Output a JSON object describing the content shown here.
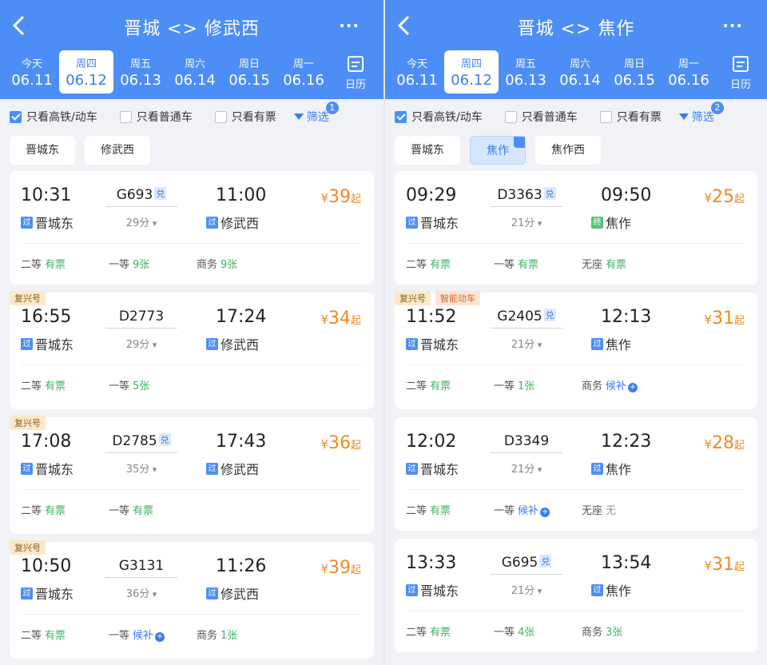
{
  "left": {
    "title": "晋城 <> 修武西",
    "more": "···",
    "dates": [
      {
        "wk": "今天",
        "dt": "06.11"
      },
      {
        "wk": "周四",
        "dt": "06.12",
        "sel": true
      },
      {
        "wk": "周五",
        "dt": "06.13"
      },
      {
        "wk": "周六",
        "dt": "06.14"
      },
      {
        "wk": "周日",
        "dt": "06.15"
      },
      {
        "wk": "周一",
        "dt": "06.16"
      }
    ],
    "calendar": "日历",
    "filters": {
      "hsr": "只看高铁/动车",
      "normal": "只看普通车",
      "avail": "只看有票",
      "screen": "筛选",
      "badge": "1"
    },
    "stations": [
      "晋城东",
      "修武西"
    ],
    "trains": [
      {
        "dep": "10:31",
        "arr": "11:00",
        "no": "G693",
        "dui": "兑",
        "dur": "29分",
        "ds": "晋城东",
        "as": "修武西",
        "asb": "过",
        "price": "39",
        "seats": [
          [
            "二等",
            "有票",
            "g"
          ],
          [
            "一等",
            "9张",
            "g"
          ],
          [
            "商务",
            "9张",
            "g"
          ]
        ]
      },
      {
        "tag": "复兴号",
        "dep": "16:55",
        "arr": "17:24",
        "no": "D2773",
        "dur": "29分",
        "ds": "晋城东",
        "as": "修武西",
        "asb": "过",
        "price": "34",
        "seats": [
          [
            "二等",
            "有票",
            "g"
          ],
          [
            "一等",
            "5张",
            "g"
          ]
        ]
      },
      {
        "tag": "复兴号",
        "dep": "17:08",
        "arr": "17:43",
        "no": "D2785",
        "dui": "兑",
        "dur": "35分",
        "ds": "晋城东",
        "as": "修武西",
        "asb": "过",
        "price": "36",
        "seats": [
          [
            "二等",
            "有票",
            "g"
          ],
          [
            "一等",
            "有票",
            "g"
          ]
        ]
      },
      {
        "tag": "复兴号",
        "dep": "10:50",
        "arr": "11:26",
        "no": "G3131",
        "dur": "36分",
        "ds": "晋城东",
        "as": "修武西",
        "asb": "过",
        "price": "39",
        "seats": [
          [
            "二等",
            "有票",
            "g"
          ],
          [
            "一等",
            "候补",
            "b"
          ],
          [
            "商务",
            "1张",
            "g"
          ]
        ]
      }
    ]
  },
  "right": {
    "title": "晋城 <> 焦作",
    "more": "···",
    "dates": [
      {
        "wk": "今天",
        "dt": "06.11"
      },
      {
        "wk": "周四",
        "dt": "06.12",
        "sel": true
      },
      {
        "wk": "周五",
        "dt": "06.13"
      },
      {
        "wk": "周六",
        "dt": "06.14"
      },
      {
        "wk": "周日",
        "dt": "06.15"
      },
      {
        "wk": "周一",
        "dt": "06.16"
      }
    ],
    "calendar": "日历",
    "filters": {
      "hsr": "只看高铁/动车",
      "normal": "只看普通车",
      "avail": "只看有票",
      "screen": "筛选",
      "badge": "2"
    },
    "stations": [
      "晋城东",
      "焦作",
      "焦作西"
    ],
    "trains": [
      {
        "dep": "09:29",
        "arr": "09:50",
        "no": "D3363",
        "dui": "兑",
        "dur": "21分",
        "ds": "晋城东",
        "as": "焦作",
        "asb": "终",
        "price": "25",
        "seats": [
          [
            "二等",
            "有票",
            "g"
          ],
          [
            "一等",
            "有票",
            "g"
          ],
          [
            "无座",
            "有票",
            "g"
          ]
        ]
      },
      {
        "tag": "复兴号",
        "tag2": "智能动车",
        "dep": "11:52",
        "arr": "12:13",
        "no": "G2405",
        "dui": "兑",
        "dur": "21分",
        "ds": "晋城东",
        "as": "焦作",
        "asb": "过",
        "price": "31",
        "seats": [
          [
            "二等",
            "有票",
            "g"
          ],
          [
            "一等",
            "1张",
            "g"
          ],
          [
            "商务",
            "候补",
            "b"
          ]
        ]
      },
      {
        "dep": "12:02",
        "arr": "12:23",
        "no": "D3349",
        "dur": "21分",
        "ds": "晋城东",
        "as": "焦作",
        "asb": "过",
        "price": "28",
        "seats": [
          [
            "二等",
            "有票",
            "g"
          ],
          [
            "一等",
            "候补",
            "b"
          ],
          [
            "无座",
            "无",
            "x"
          ]
        ]
      },
      {
        "dep": "13:33",
        "arr": "13:54",
        "no": "G695",
        "dui": "兑",
        "dur": "21分",
        "ds": "晋城东",
        "as": "焦作",
        "asb": "过",
        "price": "31",
        "seats": [
          [
            "二等",
            "有票",
            "g"
          ],
          [
            "一等",
            "4张",
            "g"
          ],
          [
            "商务",
            "3张",
            "g"
          ]
        ]
      }
    ]
  },
  "common": {
    "pass_badge": "过",
    "yuan": "¥",
    "qi": "起"
  }
}
